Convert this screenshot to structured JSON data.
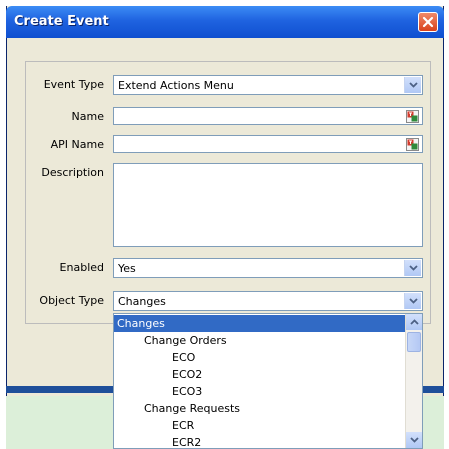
{
  "window": {
    "title": "Create Event"
  },
  "form": {
    "event_type": {
      "label": "Event Type",
      "value": "Extend Actions Menu"
    },
    "name": {
      "label": "Name",
      "value": ""
    },
    "api_name": {
      "label": "API Name",
      "value": ""
    },
    "description": {
      "label": "Description",
      "value": ""
    },
    "enabled": {
      "label": "Enabled",
      "value": "Yes"
    },
    "object_type": {
      "label": "Object Type",
      "value": "Changes"
    }
  },
  "dropdown": {
    "items": [
      {
        "label": "Changes",
        "level": 0,
        "selected": true
      },
      {
        "label": "Change Orders",
        "level": 1,
        "selected": false
      },
      {
        "label": "ECO",
        "level": 2,
        "selected": false
      },
      {
        "label": "ECO2",
        "level": 2,
        "selected": false
      },
      {
        "label": "ECO3",
        "level": 2,
        "selected": false
      },
      {
        "label": "Change Requests",
        "level": 1,
        "selected": false
      },
      {
        "label": "ECR",
        "level": 2,
        "selected": false
      },
      {
        "label": "ECR2",
        "level": 2,
        "selected": false
      }
    ]
  },
  "colors": {
    "title_bar": "#1f63e0",
    "selection": "#316ac5",
    "window_bg": "#ece9d8",
    "close_button": "#d9421c"
  },
  "icons": {
    "close": "close-icon",
    "dropdown": "chevron-down-icon",
    "translate": "translate-icon",
    "scroll_up": "chevron-up-icon",
    "scroll_down": "chevron-down-icon"
  }
}
